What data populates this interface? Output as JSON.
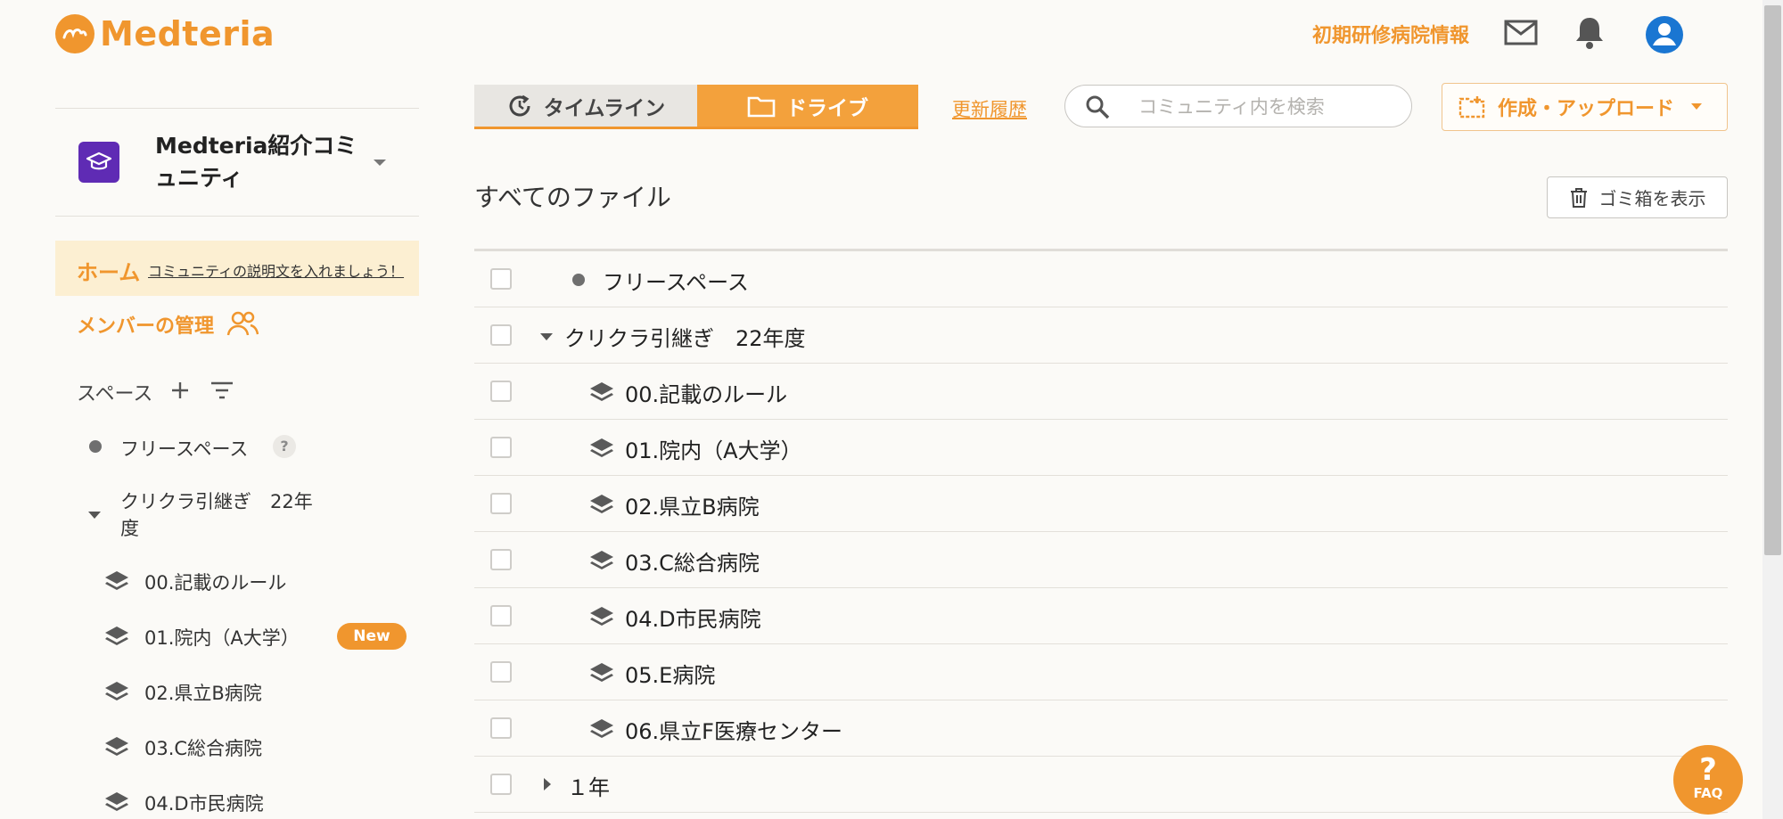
{
  "header": {
    "logo_text": "Medteria",
    "hospital_info_link": "初期研修病院情報"
  },
  "sidebar": {
    "community_name": "Medteria紹介コミュニティ",
    "home_label": "ホーム",
    "home_description": "コミュニティの説明文を入れましょう！",
    "members_label": "メンバーの管理",
    "spaces_label": "スペース",
    "free_space": "フリースペース",
    "help_mark": "?",
    "group_line1": "クリクラ引継ぎ　22年",
    "group_line2": "度",
    "items": [
      "00.記載のルール",
      "01.院内（A大学）",
      "02.県立B病院",
      "03.C総合病院",
      "04.D市民病院"
    ],
    "new_badge": "New"
  },
  "tabs": {
    "timeline": "タイムライン",
    "drive": "ドライブ"
  },
  "toolbar": {
    "history_link": "更新履歴",
    "search_placeholder": "コミュニティ内を検索",
    "create_upload": "作成・アップロード"
  },
  "main": {
    "section_title": "すべてのファイル",
    "trash_button": "ゴミ箱を表示",
    "rows": [
      {
        "label": "フリースペース"
      },
      {
        "label": "クリクラ引継ぎ　22年度"
      },
      {
        "label": "00.記載のルール"
      },
      {
        "label": "01.院内（A大学）"
      },
      {
        "label": "02.県立B病院"
      },
      {
        "label": "03.C総合病院"
      },
      {
        "label": "04.D市民病院"
      },
      {
        "label": "05.E病院"
      },
      {
        "label": "06.県立F医療センター"
      },
      {
        "label": "１年"
      }
    ]
  },
  "faq": {
    "mark": "?",
    "label": "FAQ"
  },
  "colors": {
    "accent": "#f0962e",
    "community_icon": "#5f2bb4",
    "home_bg": "#fcefd2"
  }
}
